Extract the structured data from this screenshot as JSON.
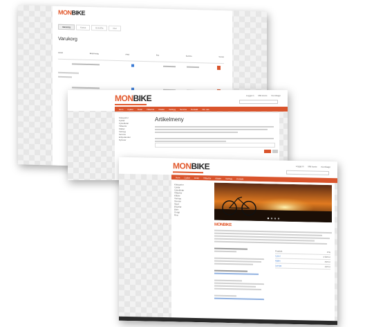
{
  "screen1": {
    "logo": {
      "mon": "MON",
      "bike": "BIKE"
    },
    "title": "Varukorg",
    "tabs": [
      "Varukorg",
      "Kassa",
      "Bekräfta",
      "Klar"
    ],
    "headers": [
      "Artikel",
      "Beskrivning",
      "Antal",
      "Pris",
      "Summa",
      "Ta bort"
    ]
  },
  "screen2": {
    "logo": {
      "mon": "MON",
      "bike": "BIKE"
    },
    "heading": "Artikelmeny",
    "nav": [
      "Hem",
      "Cyklar",
      "Delar",
      "Tillbehör",
      "Kläder",
      "Verktyg",
      "Service",
      "Kontakt",
      "Om oss"
    ],
    "sidebar": [
      "Kategorier",
      "Cyklar",
      "Cykeldelar",
      "Tillbehör",
      "Kläder",
      "Verktyg",
      "Service",
      "Erbjudanden",
      "Nyheter"
    ],
    "top_links": [
      "Logga in",
      "Mitt konto",
      "Kundvagn"
    ]
  },
  "screen3": {
    "logo": {
      "mon": "MON",
      "bike": "BIKE"
    },
    "welcome": "MONBIKE",
    "nav": [
      "Hem",
      "Cyklar",
      "Delar",
      "Tillbehör",
      "Kläder",
      "Verktyg",
      "Kontakt"
    ],
    "sidebar": [
      "Kategorier",
      "Cyklar",
      "Cykeldelar",
      "Tillbehör",
      "Kläder",
      "Verktyg",
      "Service",
      "Sport",
      "Elcyklar",
      "Barn",
      "Övrigt",
      "Rea"
    ],
    "table": [
      [
        "Produkt",
        "Pris"
      ],
      [
        "Cykel",
        "4 995 kr"
      ],
      [
        "Hjälm",
        "495 kr"
      ],
      [
        "Lampa",
        "195 kr"
      ]
    ]
  },
  "colors": {
    "accent": "#d9542c",
    "brand_orange": "#e25a2e"
  }
}
